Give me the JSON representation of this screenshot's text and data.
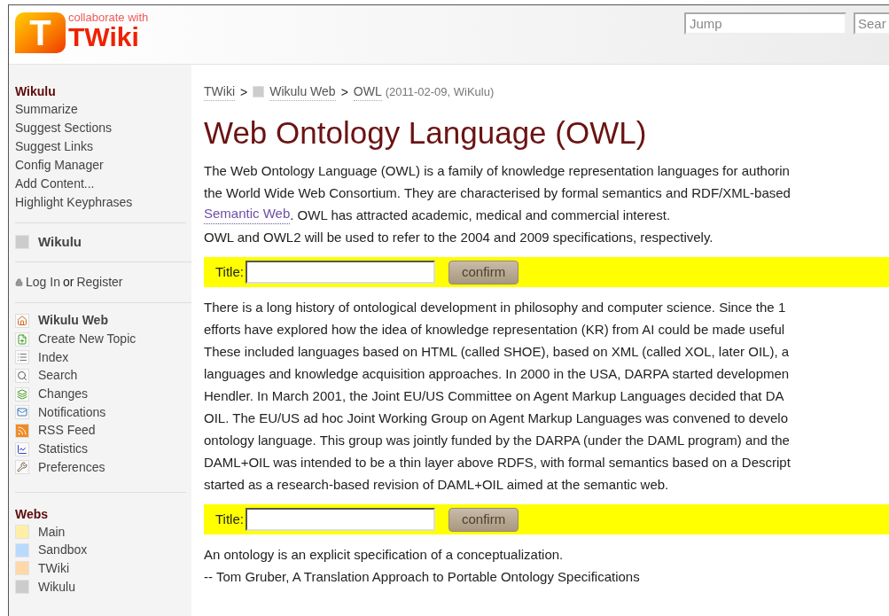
{
  "logo": {
    "tagline": "collaborate with",
    "mark": "T",
    "name": "TWiki"
  },
  "header": {
    "jump": {
      "placeholder": "Jump"
    },
    "search": {
      "placeholder": "Sear"
    }
  },
  "sidebar": {
    "wikulu": {
      "title": "Wikulu",
      "items": [
        "Summarize",
        "Suggest Sections",
        "Suggest Links",
        "Config Manager",
        "Add Content...",
        "Highlight Keyphrases"
      ]
    },
    "current_web": {
      "label": "Wikulu",
      "color": "#cccccc"
    },
    "login": {
      "login": "Log In",
      "or": "or",
      "register": "Register"
    },
    "tools": [
      {
        "kind": "home",
        "label": "Wikulu Web"
      },
      {
        "kind": "create",
        "label": "Create New Topic"
      },
      {
        "kind": "index",
        "label": "Index"
      },
      {
        "kind": "search",
        "label": "Search"
      },
      {
        "kind": "changes",
        "label": "Changes"
      },
      {
        "kind": "notify",
        "label": "Notifications"
      },
      {
        "kind": "rss",
        "label": "RSS Feed"
      },
      {
        "kind": "stats",
        "label": "Statistics"
      },
      {
        "kind": "prefs",
        "label": "Preferences"
      }
    ],
    "webs": {
      "title": "Webs",
      "items": [
        {
          "label": "Main",
          "color": "#ffefa6"
        },
        {
          "label": "Sandbox",
          "color": "#b9dafd"
        },
        {
          "label": "TWiki",
          "color": "#ffd8aa"
        },
        {
          "label": "Wikulu",
          "color": "#cccccc"
        }
      ]
    }
  },
  "breadcrumb": {
    "items": [
      "TWiki",
      "Wikulu Web",
      "OWL"
    ],
    "separator": ">",
    "info": "(2011-02-09, WiKulu)"
  },
  "title": "Web Ontology Language (OWL)",
  "content": [
    {
      "kind": "text",
      "lines": [
        "The Web Ontology Language (OWL) is a family of knowledge representation languages for authorin",
        "the World Wide Web Consortium. They are characterised by formal semantics and RDF/XML-based"
      ]
    },
    {
      "kind": "link_line",
      "link": "Semantic Web",
      "rest": ". OWL has attracted academic, medical and commercial interest."
    },
    {
      "kind": "text",
      "lines": [
        "OWL and OWL2 will be used to refer to the 2004 and 2009 specifications, respectively."
      ]
    },
    {
      "kind": "form",
      "label": "Title:",
      "button": "confirm"
    },
    {
      "kind": "text",
      "lines": [
        "There is a long history of ontological development in philosophy and computer science. Since the 1",
        "efforts have explored how the idea of knowledge representation (KR) from AI could be made useful",
        "These included languages based on HTML (called SHOE), based on XML (called XOL, later OIL), a",
        "languages and knowledge acquisition approaches. In 2000 in the USA, DARPA started developmen",
        "Hendler. In March 2001, the Joint EU/US Committee on Agent Markup Languages decided that DA",
        "OIL. The EU/US ad hoc Joint Working Group on Agent Markup Languages was convened to develo",
        "ontology language. This group was jointly funded by the DARPA (under the DAML program) and the",
        "DAML+OIL was intended to be a thin layer above RDFS, with formal semantics based on a Descript",
        "started as a research-based revision of DAML+OIL aimed at the semantic web."
      ]
    },
    {
      "kind": "form",
      "label": "Title:",
      "button": "confirm"
    },
    {
      "kind": "text",
      "lines": [
        "An ontology is an explicit specification of a conceptualization.",
        "-- Tom Gruber, A Translation Approach to Portable Ontology Specifications"
      ]
    }
  ]
}
